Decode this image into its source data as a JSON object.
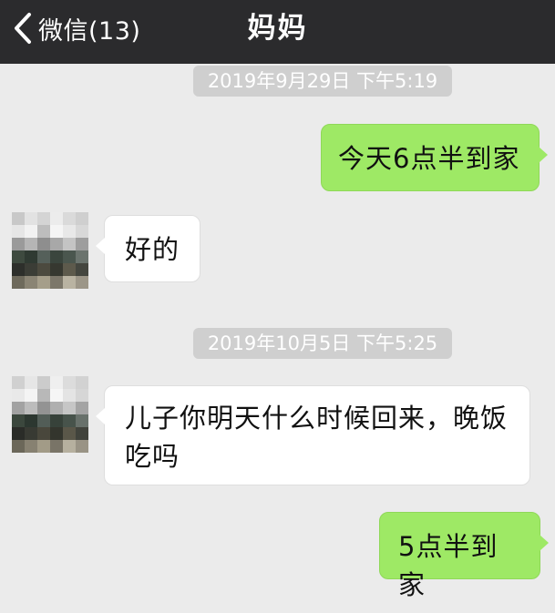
{
  "nav": {
    "back_label": "微信(13)",
    "title": "妈妈"
  },
  "messages": [
    {
      "type": "timestamp",
      "text": "2019年9月29日 下午5:19"
    },
    {
      "type": "sent",
      "text": "今天6点半到家"
    },
    {
      "type": "received",
      "text": "好的"
    },
    {
      "type": "timestamp",
      "text": "2019年10月5日 下午5:25"
    },
    {
      "type": "received",
      "text": "儿子你明天什么时候回来，晚饭吃吗"
    },
    {
      "type": "sent",
      "text": "5点半到家"
    }
  ],
  "colors": {
    "nav_background": "#2b2b2d",
    "chat_background": "#ebebeb",
    "sent_bubble": "#9ee965",
    "received_bubble": "#ffffff",
    "timestamp_background": "#cfcfcf"
  },
  "icons": {
    "back": "chevron-left-icon",
    "avatar": "pixelated-avatar"
  }
}
